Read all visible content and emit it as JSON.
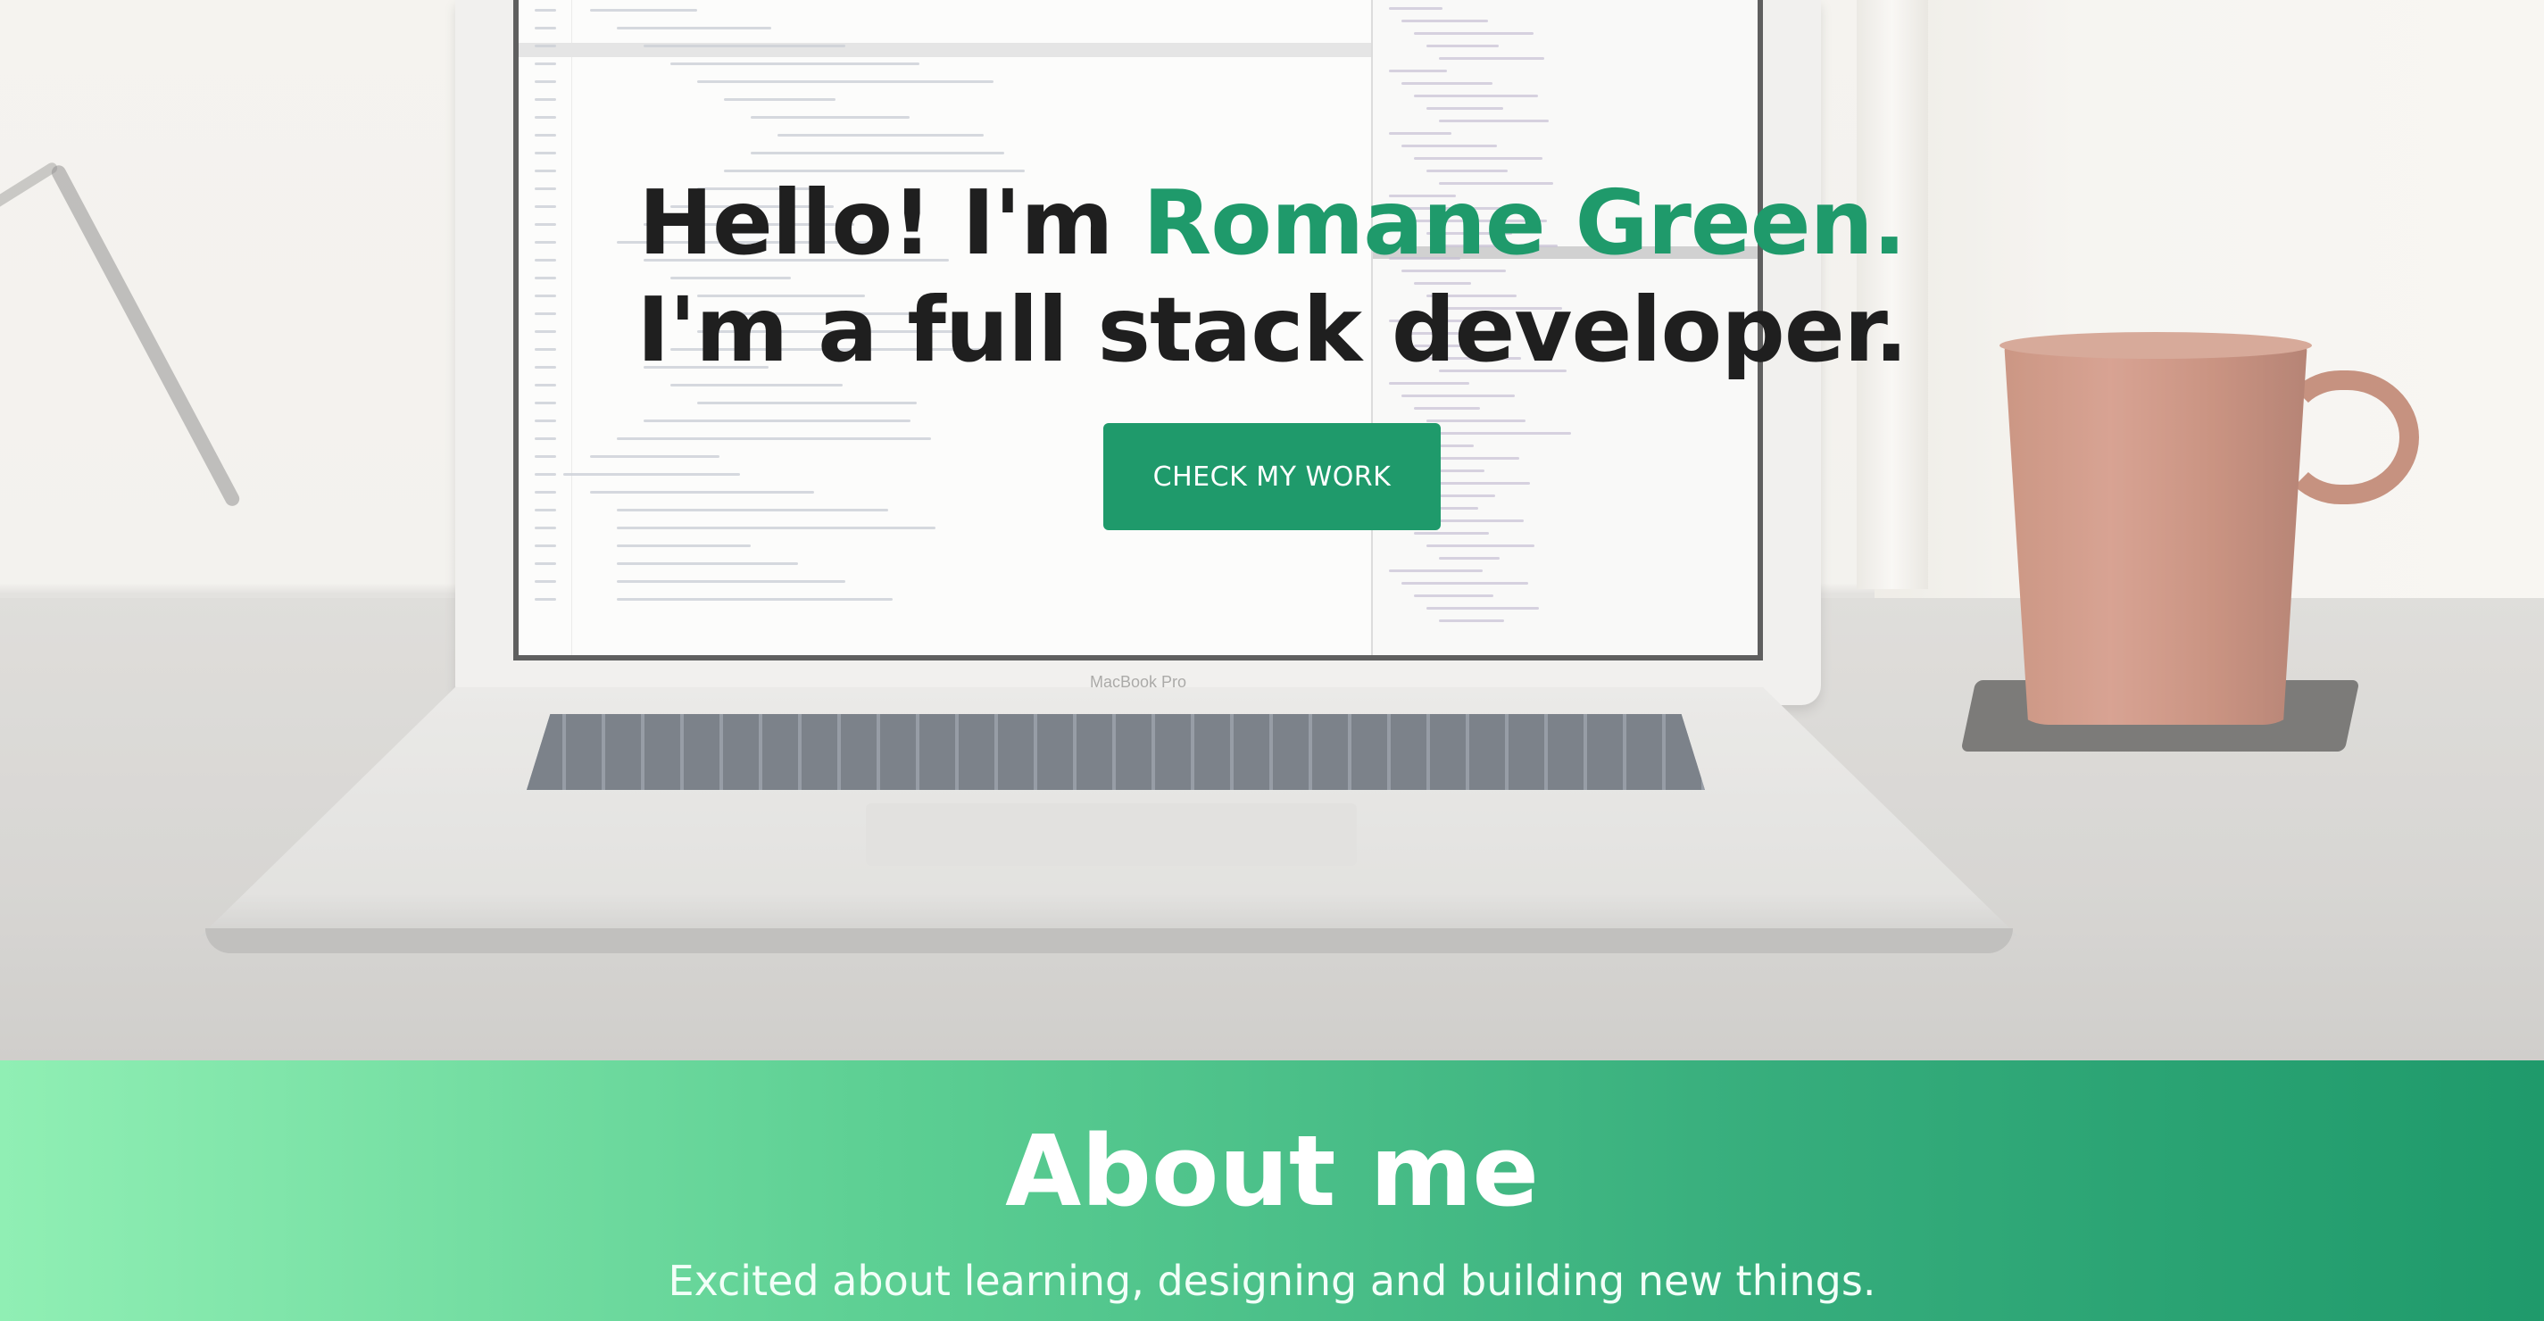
{
  "hero": {
    "greeting": "Hello! I'm ",
    "name": "Romane Green.",
    "tagline": "I'm a full stack developer.",
    "cta_label": "CHECK MY WORK",
    "laptop_label": "MacBook Pro"
  },
  "about": {
    "title": "About me",
    "subtitle": "Excited about learning, designing and building new things."
  },
  "colors": {
    "accent": "#1f9a6b",
    "gradient_start": "#90efb4",
    "gradient_end": "#1f9a6b"
  }
}
